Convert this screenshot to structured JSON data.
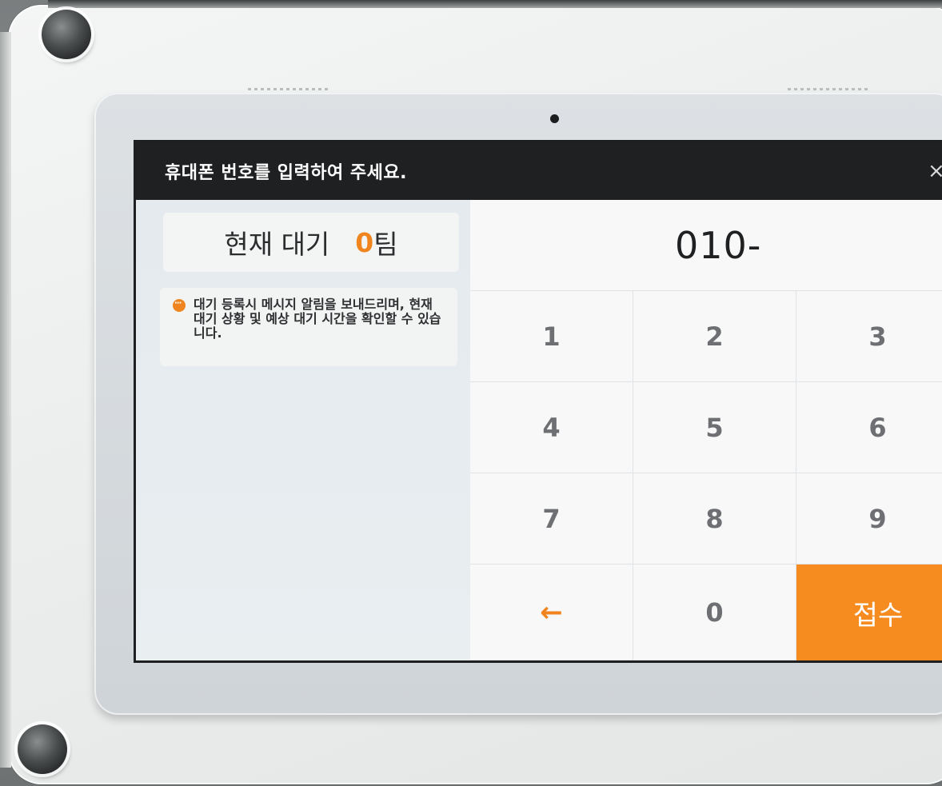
{
  "header": {
    "title": "휴대폰 번호를 입력하여 주세요.",
    "close_glyph": "×"
  },
  "status": {
    "wait_label": "현재 대기",
    "wait_count": "0",
    "wait_unit": "팀"
  },
  "notice": {
    "text": "대기 등록시 메시지 알림을 보내드리며, 현재 대기 상황 및 예상 대기 시간을 확인할 수 있습니다."
  },
  "phone_input": {
    "value": "010-"
  },
  "keypad": {
    "k1": "1",
    "k2": "2",
    "k3": "3",
    "k4": "4",
    "k5": "5",
    "k6": "6",
    "k7": "7",
    "k8": "8",
    "k9": "9",
    "back": "←",
    "k0": "0",
    "submit": "접수"
  },
  "colors": {
    "accent": "#f68b20",
    "titlebar": "#1f2022"
  }
}
